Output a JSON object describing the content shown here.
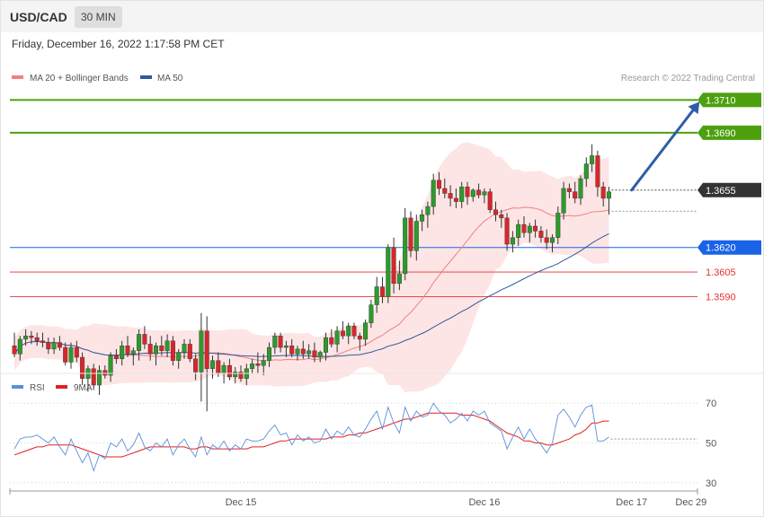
{
  "header": {
    "pair": "USD/CAD",
    "timeframe": "30 MIN",
    "datetime": "Friday, December 16, 2022 1:17:58 PM CET"
  },
  "colors": {
    "bull": "#2c9b2c",
    "bear": "#d9262c",
    "ma20": "#f08080",
    "ma50": "#2f5a9e",
    "bands": "#fde1e1",
    "resistance": "#4ca00e",
    "support": "#1a63e8",
    "pivot_red": "#e8312f",
    "current": "#333333",
    "arrow": "#2e5da8",
    "rsi": "#5b8ed8",
    "rsi_ma": "#e02020"
  },
  "chart_data": [
    {
      "type": "candlestick",
      "instrument": "USD/CAD",
      "legend": {
        "ma20": "MA 20 + Bollinger Bands",
        "ma50": "MA 50",
        "credit": "Research © 2022 Trading Central"
      },
      "ylim": [
        1.353,
        1.3725
      ],
      "levels": [
        {
          "label": "1.3710",
          "value": 1.371,
          "kind": "resistance"
        },
        {
          "label": "1.3690",
          "value": 1.369,
          "kind": "resistance"
        },
        {
          "label": "1.3655",
          "value": 1.3655,
          "kind": "current"
        },
        {
          "label": "1.3620",
          "value": 1.362,
          "kind": "pivot"
        },
        {
          "label": "1.3605",
          "value": 1.3605,
          "kind": "support"
        },
        {
          "label": "1.3590",
          "value": 1.359,
          "kind": "support"
        }
      ],
      "x_ticks": [
        "Dec 15",
        "Dec 16",
        "Dec 17",
        "Dec 29"
      ],
      "x_tick_index": [
        40,
        83,
        109,
        119.5
      ],
      "target": {
        "from_index": 109,
        "from": 1.3655,
        "to_index": 121,
        "to": 1.371
      },
      "candles": [
        [
          1.356,
          1.3568,
          1.3553,
          1.3555
        ],
        [
          1.3555,
          1.3566,
          1.3551,
          1.3564
        ],
        [
          1.3564,
          1.357,
          1.356,
          1.3566
        ],
        [
          1.3566,
          1.3569,
          1.3561,
          1.3565
        ],
        [
          1.3565,
          1.3568,
          1.356,
          1.3563
        ],
        [
          1.3563,
          1.3568,
          1.3559,
          1.3562
        ],
        [
          1.3562,
          1.3565,
          1.3555,
          1.3558
        ],
        [
          1.3558,
          1.3565,
          1.3555,
          1.3562
        ],
        [
          1.3562,
          1.3566,
          1.3557,
          1.3559
        ],
        [
          1.3559,
          1.3562,
          1.3548,
          1.355
        ],
        [
          1.355,
          1.3562,
          1.3546,
          1.3559
        ],
        [
          1.3559,
          1.3563,
          1.355,
          1.3553
        ],
        [
          1.3553,
          1.3556,
          1.3536,
          1.354
        ],
        [
          1.354,
          1.3548,
          1.3532,
          1.3546
        ],
        [
          1.3546,
          1.3549,
          1.3533,
          1.3536
        ],
        [
          1.3536,
          1.3548,
          1.353,
          1.3545
        ],
        [
          1.3545,
          1.3548,
          1.354,
          1.3542
        ],
        [
          1.3542,
          1.3556,
          1.3538,
          1.3554
        ],
        [
          1.3554,
          1.3558,
          1.3549,
          1.3552
        ],
        [
          1.3552,
          1.3563,
          1.3548,
          1.356
        ],
        [
          1.356,
          1.3566,
          1.3553,
          1.3555
        ],
        [
          1.3555,
          1.3559,
          1.3548,
          1.3557
        ],
        [
          1.3557,
          1.357,
          1.3551,
          1.3567
        ],
        [
          1.3567,
          1.3572,
          1.3558,
          1.3561
        ],
        [
          1.3561,
          1.3566,
          1.3551,
          1.3555
        ],
        [
          1.3555,
          1.3562,
          1.3548,
          1.356
        ],
        [
          1.356,
          1.3566,
          1.3554,
          1.3557
        ],
        [
          1.3557,
          1.3567,
          1.3553,
          1.3563
        ],
        [
          1.3563,
          1.3566,
          1.3548,
          1.3551
        ],
        [
          1.3551,
          1.3558,
          1.3546,
          1.3556
        ],
        [
          1.3556,
          1.3564,
          1.3552,
          1.3561
        ],
        [
          1.3561,
          1.3564,
          1.355,
          1.3552
        ],
        [
          1.3552,
          1.3555,
          1.3539,
          1.3544
        ],
        [
          1.3544,
          1.358,
          1.3526,
          1.3569
        ],
        [
          1.3569,
          1.3578,
          1.352,
          1.3546
        ],
        [
          1.3546,
          1.3554,
          1.354,
          1.3551
        ],
        [
          1.3551,
          1.3556,
          1.3541,
          1.3543
        ],
        [
          1.3543,
          1.355,
          1.3537,
          1.3548
        ],
        [
          1.3548,
          1.3552,
          1.3539,
          1.3541
        ],
        [
          1.3541,
          1.3547,
          1.3537,
          1.3544
        ],
        [
          1.3544,
          1.3548,
          1.3538,
          1.354
        ],
        [
          1.354,
          1.3549,
          1.3536,
          1.3546
        ],
        [
          1.3546,
          1.3552,
          1.3543,
          1.3549
        ],
        [
          1.3549,
          1.3556,
          1.3543,
          1.3548
        ],
        [
          1.3548,
          1.3555,
          1.3542,
          1.3551
        ],
        [
          1.3551,
          1.3562,
          1.3547,
          1.3559
        ],
        [
          1.3559,
          1.3568,
          1.3555,
          1.3566
        ],
        [
          1.3566,
          1.3568,
          1.3556,
          1.3559
        ],
        [
          1.3559,
          1.3563,
          1.3553,
          1.356
        ],
        [
          1.356,
          1.3564,
          1.3553,
          1.3555
        ],
        [
          1.3555,
          1.356,
          1.3551,
          1.3558
        ],
        [
          1.3558,
          1.3563,
          1.3552,
          1.3555
        ],
        [
          1.3555,
          1.3561,
          1.3552,
          1.3557
        ],
        [
          1.3557,
          1.3562,
          1.355,
          1.3553
        ],
        [
          1.3553,
          1.3557,
          1.355,
          1.3556
        ],
        [
          1.3556,
          1.3568,
          1.3551,
          1.3565
        ],
        [
          1.3565,
          1.357,
          1.3559,
          1.3561
        ],
        [
          1.3561,
          1.3572,
          1.3556,
          1.3569
        ],
        [
          1.3569,
          1.3575,
          1.3564,
          1.3566
        ],
        [
          1.3566,
          1.3574,
          1.3561,
          1.3572
        ],
        [
          1.3572,
          1.3574,
          1.3564,
          1.3566
        ],
        [
          1.3566,
          1.3568,
          1.3557,
          1.3564
        ],
        [
          1.3564,
          1.3576,
          1.356,
          1.3574
        ],
        [
          1.3574,
          1.3588,
          1.3571,
          1.3585
        ],
        [
          1.3585,
          1.3602,
          1.358,
          1.3596
        ],
        [
          1.3596,
          1.3602,
          1.3586,
          1.359
        ],
        [
          1.359,
          1.3622,
          1.3586,
          1.362
        ],
        [
          1.362,
          1.3626,
          1.3592,
          1.3598
        ],
        [
          1.3598,
          1.3612,
          1.3594,
          1.3604
        ],
        [
          1.3604,
          1.3644,
          1.36,
          1.3638
        ],
        [
          1.3638,
          1.3642,
          1.3614,
          1.3618
        ],
        [
          1.3618,
          1.364,
          1.3612,
          1.3636
        ],
        [
          1.3636,
          1.3643,
          1.363,
          1.364
        ],
        [
          1.364,
          1.3648,
          1.3632,
          1.3645
        ],
        [
          1.3645,
          1.3665,
          1.364,
          1.3661
        ],
        [
          1.3661,
          1.3666,
          1.3652,
          1.3656
        ],
        [
          1.3656,
          1.3662,
          1.365,
          1.3653
        ],
        [
          1.3653,
          1.3658,
          1.3645,
          1.365
        ],
        [
          1.365,
          1.3656,
          1.3644,
          1.3648
        ],
        [
          1.3648,
          1.366,
          1.3644,
          1.3657
        ],
        [
          1.3657,
          1.366,
          1.3646,
          1.3651
        ],
        [
          1.3651,
          1.3656,
          1.3648,
          1.3655
        ],
        [
          1.3655,
          1.3659,
          1.365,
          1.3652
        ],
        [
          1.3652,
          1.3656,
          1.3647,
          1.3654
        ],
        [
          1.3654,
          1.3656,
          1.3641,
          1.3643
        ],
        [
          1.3643,
          1.3648,
          1.3636,
          1.364
        ],
        [
          1.364,
          1.3643,
          1.3632,
          1.3638
        ],
        [
          1.3638,
          1.3641,
          1.3618,
          1.3622
        ],
        [
          1.3622,
          1.363,
          1.3617,
          1.3626
        ],
        [
          1.3626,
          1.3637,
          1.3621,
          1.3634
        ],
        [
          1.3634,
          1.3639,
          1.3626,
          1.3629
        ],
        [
          1.3629,
          1.3635,
          1.3623,
          1.3633
        ],
        [
          1.3633,
          1.3637,
          1.3626,
          1.363
        ],
        [
          1.363,
          1.3633,
          1.3623,
          1.3626
        ],
        [
          1.3626,
          1.3631,
          1.3619,
          1.3623
        ],
        [
          1.3623,
          1.3628,
          1.3617,
          1.3626
        ],
        [
          1.3626,
          1.3645,
          1.3622,
          1.3641
        ],
        [
          1.3641,
          1.366,
          1.3637,
          1.3656
        ],
        [
          1.3656,
          1.3659,
          1.365,
          1.3654
        ],
        [
          1.3654,
          1.366,
          1.3647,
          1.365
        ],
        [
          1.365,
          1.3664,
          1.3646,
          1.3662
        ],
        [
          1.3662,
          1.3675,
          1.3657,
          1.3671
        ],
        [
          1.3671,
          1.3683,
          1.3666,
          1.3676
        ],
        [
          1.3676,
          1.3679,
          1.3651,
          1.3657
        ],
        [
          1.3657,
          1.366,
          1.3645,
          1.365
        ],
        [
          1.365,
          1.3657,
          1.364,
          1.3654
        ]
      ]
    },
    {
      "type": "line",
      "title": "RSI",
      "legend": {
        "rsi": "RSI",
        "ma": "9MA"
      },
      "ylim": [
        20,
        80
      ],
      "yticks": [
        70,
        50,
        30
      ],
      "current_level": 52,
      "rsi": [
        47,
        52,
        53,
        53,
        54,
        52,
        50,
        53,
        48,
        44,
        52,
        46,
        40,
        45,
        36,
        44,
        42,
        50,
        48,
        52,
        46,
        49,
        55,
        48,
        46,
        50,
        48,
        52,
        44,
        49,
        52,
        47,
        43,
        53,
        44,
        49,
        47,
        51,
        46,
        49,
        47,
        52,
        51,
        51,
        52,
        56,
        59,
        54,
        55,
        49,
        54,
        51,
        53,
        50,
        51,
        57,
        52,
        56,
        54,
        58,
        54,
        53,
        57,
        62,
        66,
        57,
        68,
        60,
        55,
        68,
        61,
        66,
        63,
        64,
        70,
        66,
        64,
        60,
        62,
        65,
        61,
        66,
        64,
        66,
        60,
        58,
        56,
        47,
        53,
        58,
        52,
        57,
        52,
        49,
        45,
        50,
        64,
        67,
        63,
        58,
        64,
        68,
        69,
        51,
        51,
        53
      ],
      "rsi_ma": [
        44,
        45,
        46,
        47,
        48,
        48,
        49,
        49,
        49,
        49,
        49,
        48,
        47,
        46,
        45,
        44,
        43,
        43,
        43,
        43,
        44,
        45,
        46,
        47,
        48,
        48,
        48,
        48,
        48,
        48,
        48,
        47,
        47,
        48,
        48,
        47,
        47,
        47,
        47,
        47,
        47,
        47,
        48,
        48,
        48,
        49,
        50,
        51,
        51,
        52,
        52,
        52,
        52,
        52,
        52,
        52,
        53,
        53,
        53,
        54,
        54,
        55,
        55,
        56,
        57,
        58,
        59,
        60,
        61,
        62,
        62,
        63,
        64,
        65,
        65,
        65,
        65,
        65,
        65,
        64,
        64,
        64,
        63,
        62,
        61,
        59,
        57,
        55,
        54,
        53,
        51,
        51,
        50,
        50,
        49,
        49,
        50,
        51,
        52,
        54,
        55,
        57,
        60,
        60,
        61,
        61
      ]
    }
  ]
}
